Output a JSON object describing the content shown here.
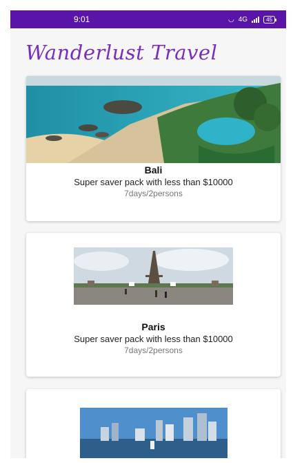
{
  "status_bar": {
    "time": "9:01",
    "network": "4G",
    "battery": "45"
  },
  "app": {
    "title": "Wanderlust Travel"
  },
  "destinations": [
    {
      "name": "Bali",
      "description": "Super saver pack with less than $10000",
      "duration": "7days/2persons",
      "image_icon": "bali-beach-resort-photo"
    },
    {
      "name": "Paris",
      "description": "Super saver pack with less than $10000",
      "duration": "7days/2persons",
      "image_icon": "eiffel-tower-photo"
    },
    {
      "name": "",
      "description": "",
      "duration": "",
      "image_icon": "singapore-skyline-photo"
    }
  ],
  "colors": {
    "status_bar": "#5a14a8",
    "title": "#7a2fb8"
  }
}
